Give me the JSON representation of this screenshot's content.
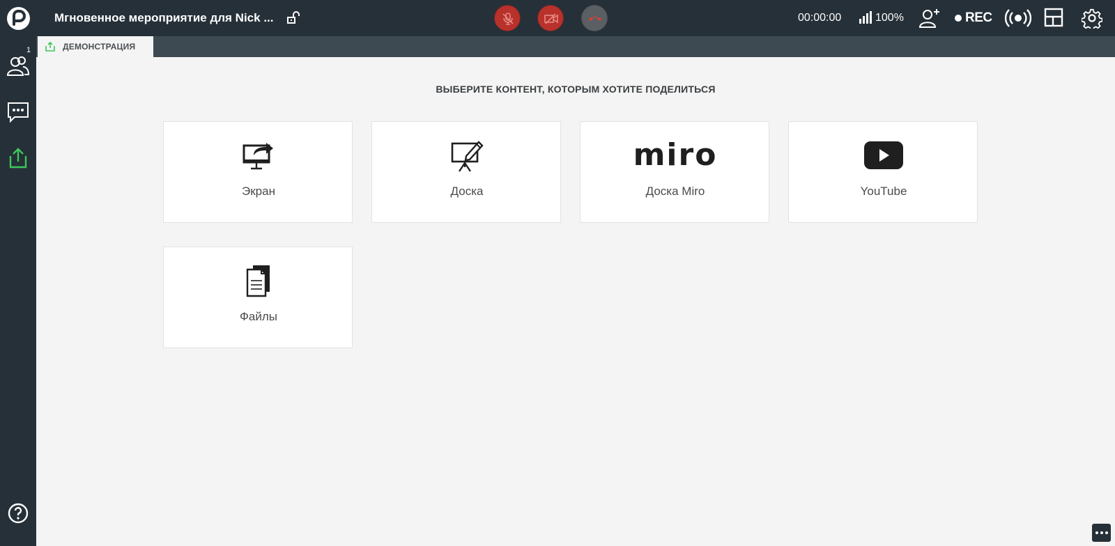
{
  "topbar": {
    "title": "Мгновенное мероприятие для Nick ...",
    "timer": "00:00:00",
    "signal": "100%",
    "rec_label": "REC"
  },
  "sidebar": {
    "participants_count": "1"
  },
  "tabs": [
    {
      "label": "ДЕМОНСТРАЦИЯ"
    }
  ],
  "main": {
    "heading": "ВЫБЕРИТЕ КОНТЕНТ, КОТОРЫМ ХОТИТЕ ПОДЕЛИТЬСЯ",
    "cards": [
      {
        "label": "Экран",
        "icon": "screen-share-icon"
      },
      {
        "label": "Доска",
        "icon": "whiteboard-icon"
      },
      {
        "label": "Доска Miro",
        "icon": "miro-logo",
        "logo_text": "miro"
      },
      {
        "label": "YouTube",
        "icon": "youtube-icon"
      },
      {
        "label": "Файлы",
        "icon": "files-icon"
      }
    ]
  },
  "colors": {
    "topbar_bg": "#263038",
    "accent_green": "#3cc85a",
    "mute_red": "#b8312b",
    "hangup_red": "#e83b2e"
  }
}
